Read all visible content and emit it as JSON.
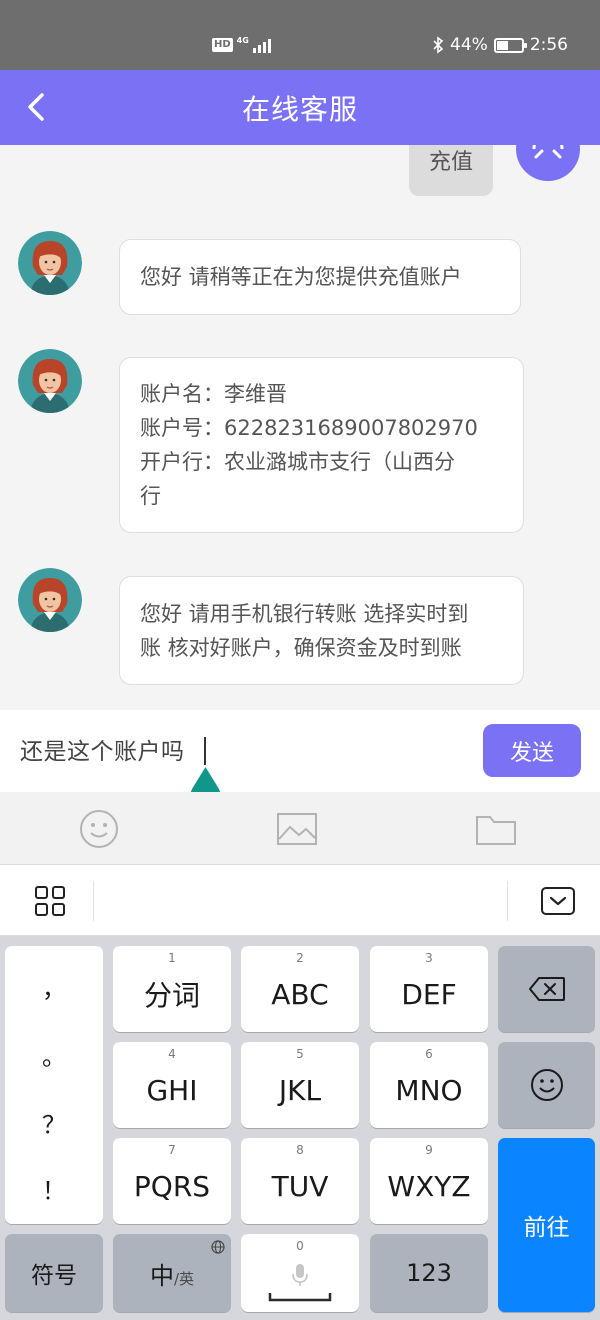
{
  "status_bar": {
    "hd": "HD",
    "network": "4G",
    "battery_percent": "44%",
    "time": "2:56"
  },
  "header": {
    "title": "在线客服"
  },
  "chat": {
    "user_message": "充值",
    "agent_messages": [
      {
        "lines": [
          "您好  请稍等正在为您提供充值账户"
        ]
      },
      {
        "lines": [
          "账户名：李维晋",
          "账户号：6228231689007802970",
          "开户行：农业潞城市支行（山西分",
          "行"
        ]
      },
      {
        "lines": [
          "您好 请用手机银行转账 选择实时到",
          "账 核对好账户，确保资金及时到账"
        ]
      }
    ]
  },
  "composer": {
    "input_value": "还是这个账户吗",
    "send_label": "发送"
  },
  "attachments": {
    "icons": [
      "emoji-icon",
      "image-icon",
      "folder-icon"
    ]
  },
  "keyboard": {
    "punctuation": [
      "，",
      "。",
      "？",
      "！"
    ],
    "keys": [
      {
        "num": "1",
        "label": "分词"
      },
      {
        "num": "2",
        "label": "ABC"
      },
      {
        "num": "3",
        "label": "DEF"
      },
      {
        "num": "4",
        "label": "GHI"
      },
      {
        "num": "5",
        "label": "JKL"
      },
      {
        "num": "6",
        "label": "MNO"
      },
      {
        "num": "7",
        "label": "PQRS"
      },
      {
        "num": "8",
        "label": "TUV"
      },
      {
        "num": "9",
        "label": "WXYZ"
      }
    ],
    "symbols_label": "符号",
    "chinese_label": "中",
    "english_label": "/英",
    "space_num": "0",
    "numbers_label": "123",
    "go_label": "前往"
  },
  "colors": {
    "accent": "#7b71f5",
    "status_bar": "#6e6e6e",
    "enter_key": "#0a84ff"
  }
}
